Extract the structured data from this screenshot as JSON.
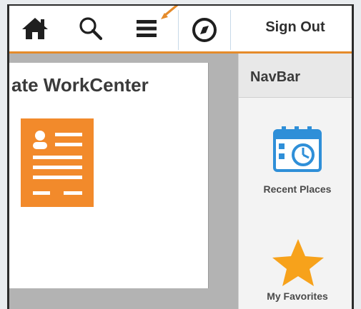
{
  "topbar": {
    "signout_label": "Sign Out",
    "icons": [
      "home-icon",
      "search-icon",
      "menu-icon",
      "compass-icon"
    ]
  },
  "workcenter": {
    "title": "ate WorkCenter"
  },
  "navbar": {
    "title": "NavBar",
    "items": [
      {
        "label": "Recent Places",
        "icon": "calendar-clock-icon"
      },
      {
        "label": "My Favorites",
        "icon": "star-icon"
      }
    ]
  },
  "colors": {
    "accent": "#e58b2b",
    "tile_blue": "#2f8fd8",
    "star": "#f7a21b"
  }
}
